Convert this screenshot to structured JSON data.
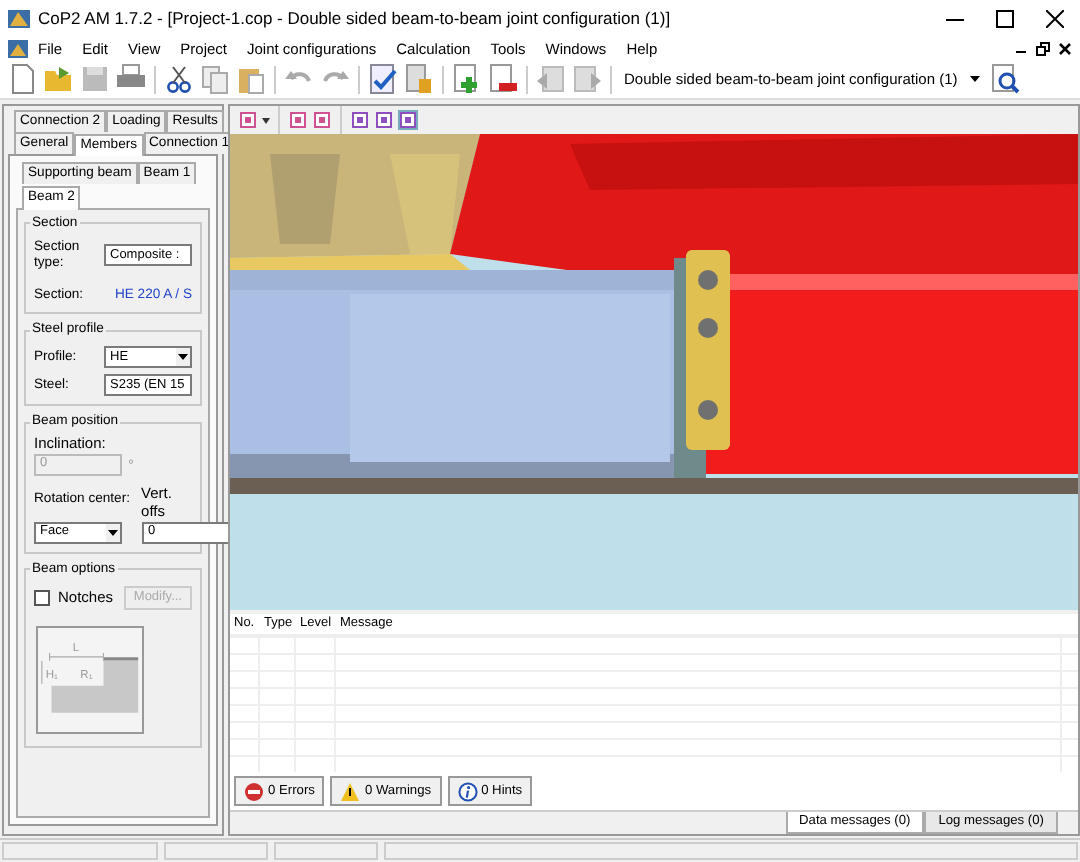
{
  "window": {
    "title": "CoP2 AM 1.7.2 - [Project-1.cop - Double sided beam-to-beam joint configuration (1)]"
  },
  "menu": [
    "File",
    "Edit",
    "View",
    "Project",
    "Joint configurations",
    "Calculation",
    "Tools",
    "Windows",
    "Help"
  ],
  "toolbar": {
    "configuration": "Double sided beam-to-beam joint configuration (1)"
  },
  "left_panel": {
    "tab_rows": [
      [
        {
          "label": "Connection 2",
          "selected": false
        },
        {
          "label": "Loading",
          "selected": false
        },
        {
          "label": "Results",
          "selected": false
        }
      ],
      [
        {
          "label": "General",
          "selected": false
        },
        {
          "label": "Members",
          "selected": true
        },
        {
          "label": "Connection 1",
          "selected": false
        }
      ]
    ],
    "sub_tab_rows": [
      [
        {
          "label": "Supporting beam",
          "selected": false
        },
        {
          "label": "Beam 1",
          "selected": false
        }
      ],
      [
        {
          "label": "Beam 2",
          "selected": true
        }
      ]
    ],
    "section": {
      "title": "Section",
      "type_label": "Section type:",
      "type_value": "Composite :",
      "section_label": "Section:",
      "section_value": "HE 220 A / S"
    },
    "steel_profile": {
      "title": "Steel profile",
      "profile_label": "Profile:",
      "profile_value": "HE",
      "steel_label": "Steel:",
      "steel_value": "S235 (EN 15"
    },
    "beam_position": {
      "title": "Beam position",
      "inclination_label": "Inclination:",
      "inclination_value": "0",
      "inclination_unit": "°",
      "inclination_disabled": true,
      "rotation_label": "Rotation center:",
      "rotation_value": "Face",
      "offset_label": "Vert. offs",
      "offset_value": "0"
    },
    "beam_options": {
      "title": "Beam options",
      "notches_label": "Notches",
      "notches_checked": false,
      "modify_label": "Modify...",
      "modify_disabled": true,
      "diagram_labels": [
        "L",
        "H₁",
        "R₁"
      ]
    }
  },
  "view_toolbar": [
    {
      "selected": false
    },
    {
      "selected": false
    },
    {
      "selected": false
    },
    {
      "selected": false
    },
    {
      "selected": false
    },
    {
      "selected": true
    }
  ],
  "messages": {
    "columns": [
      "No.",
      "Type",
      "Level",
      "Message"
    ],
    "filters": [
      {
        "kind": "error",
        "label": "0 Errors"
      },
      {
        "kind": "warning",
        "label": "0 Warnings"
      },
      {
        "kind": "hint",
        "label": "0 Hints"
      }
    ],
    "tabs": [
      {
        "label": "Data messages (0)",
        "selected": true
      },
      {
        "label": "Log messages (0)",
        "selected": false
      }
    ]
  }
}
